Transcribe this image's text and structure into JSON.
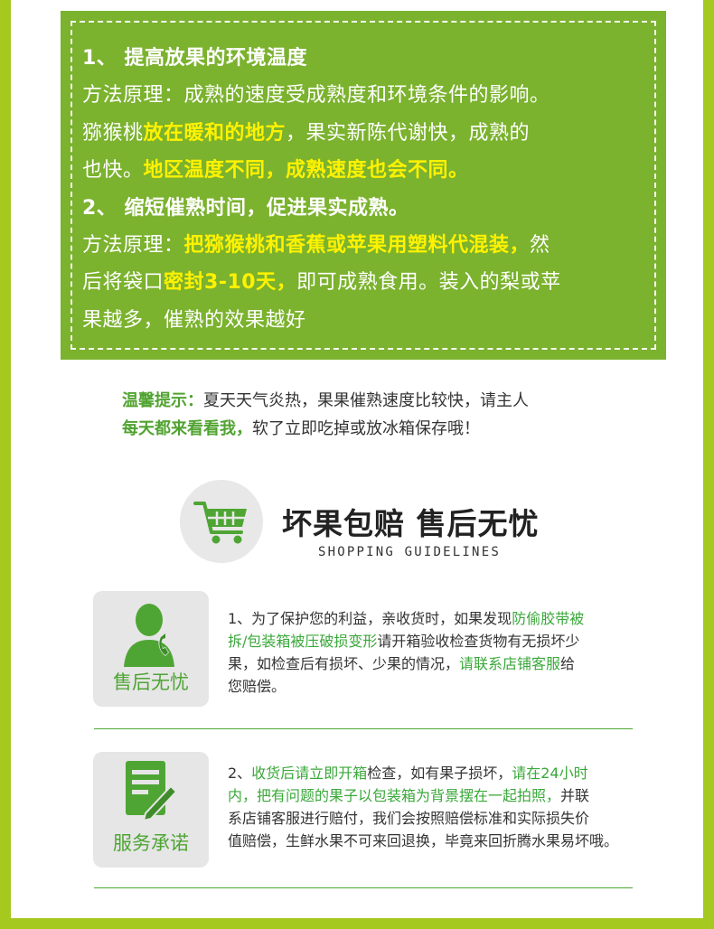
{
  "methods": {
    "lines": [
      {
        "type": "h",
        "parts": [
          {
            "text": "1、 提高放果的环境温度"
          }
        ]
      },
      {
        "type": "n",
        "parts": [
          {
            "text": "方法原理：成熟的速度受成熟度和环境条件的影响。"
          }
        ]
      },
      {
        "type": "n",
        "parts": [
          {
            "text": "猕猴桃"
          },
          {
            "text": "放在暖和的地方",
            "hl": true
          },
          {
            "text": "，果实新陈代谢快，成熟的"
          }
        ]
      },
      {
        "type": "n",
        "parts": [
          {
            "text": "也快。"
          },
          {
            "text": "地区温度不同，成熟速度也会不同。",
            "hl": true
          }
        ]
      },
      {
        "type": "h",
        "parts": [
          {
            "text": "2、 缩短催熟时间，促进果实成熟。"
          }
        ]
      },
      {
        "type": "n",
        "parts": [
          {
            "text": "方法原理："
          },
          {
            "text": "把猕猴桃和香蕉或苹果用塑料代混装，",
            "hl": true
          },
          {
            "text": "然"
          }
        ]
      },
      {
        "type": "n",
        "parts": [
          {
            "text": "后将袋口"
          },
          {
            "text": "密封3-10天，",
            "hl": true
          },
          {
            "text": "即可成熟食用。装入的梨或苹"
          }
        ]
      },
      {
        "type": "n",
        "parts": [
          {
            "text": "果越多，催熟的效果越好"
          }
        ]
      }
    ]
  },
  "tip": {
    "label": "温馨提示：",
    "text1": "夏天天气炎热，果果催熟速度比较快，请主人",
    "label2": "每天都来看看我，",
    "text2": "软了立即吃掉或放冰箱保存哦！"
  },
  "guidelines": {
    "title": "坏果包赔 售后无忧",
    "subtitle": "SHOPPING GUIDELINES",
    "icon": "shopping-cart-icon"
  },
  "services": [
    {
      "label": "售后无忧",
      "icon": "customer-service-icon",
      "lines": [
        [
          {
            "text": "1、为了保护您的利益，亲收货时，如果发现"
          },
          {
            "text": "防偷胶带被",
            "g": true
          }
        ],
        [
          {
            "text": "拆/包装箱被压破损变形",
            "g": true
          },
          {
            "text": "请开箱验收检查货物有无损坏少"
          }
        ],
        [
          {
            "text": "果，如检查后有损坏、少果的情况，"
          },
          {
            "text": "请联系店铺客服",
            "g": true
          },
          {
            "text": "给"
          }
        ],
        [
          {
            "text": "您赔偿。"
          }
        ]
      ]
    },
    {
      "label": "服务承诺",
      "icon": "document-pen-icon",
      "lines": [
        [
          {
            "text": "2、"
          },
          {
            "text": "收货后请立即开箱",
            "g": true
          },
          {
            "text": "检查，如有果子损坏，"
          },
          {
            "text": "请在24小时",
            "g": true
          }
        ],
        [
          {
            "text": "内，把有问题的果子以包装箱为背景摆在一起拍照，",
            "g": true
          },
          {
            "text": "并联"
          }
        ],
        [
          {
            "text": "系店铺客服进行赔付，我们会按照赔偿标准和实际损失价"
          }
        ],
        [
          {
            "text": "值赔偿，生鲜水果不可来回退换，毕竟来回折腾水果易坏哦。"
          }
        ]
      ]
    }
  ],
  "colors": {
    "frame": "#a5c91f",
    "box": "#7bb22e",
    "highlight": "#fff200",
    "green_text": "#4ea534"
  }
}
